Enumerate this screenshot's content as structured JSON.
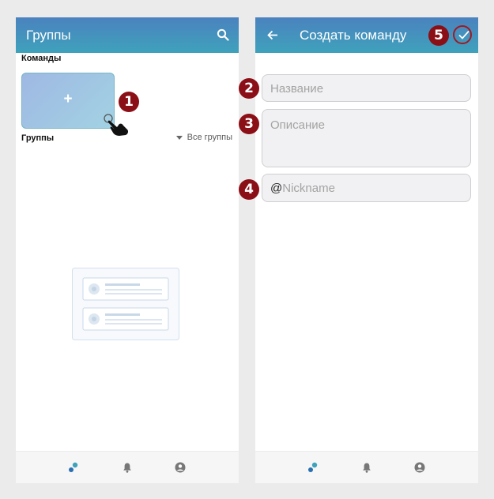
{
  "left_screen": {
    "appbar": {
      "title": "Группы",
      "search_icon": "search-icon"
    },
    "teams_label": "Команды",
    "add_team_card": {
      "plus": "+"
    },
    "groups_label": "Группы",
    "all_groups": "Все группы",
    "bottom_nav": {
      "icons": [
        "groups-icon",
        "bell-icon",
        "profile-icon"
      ],
      "active_color": "#3fa2bb"
    }
  },
  "right_screen": {
    "appbar": {
      "title": "Создать команду",
      "back_icon": "arrow-left-icon",
      "confirm_icon": "check-icon"
    },
    "fields": {
      "name_placeholder": "Название",
      "description_placeholder": "Описание",
      "nickname_prefix": "@",
      "nickname_placeholder": "Nickname"
    },
    "bottom_nav": {
      "icons": [
        "groups-icon",
        "bell-icon",
        "profile-icon"
      ],
      "active_color": "#3fa2bb"
    }
  },
  "annotations": [
    "1",
    "2",
    "3",
    "4",
    "5"
  ],
  "colors": {
    "appbar_start": "#4a82bf",
    "appbar_end": "#3fa2bb",
    "badge": "#8b0f16"
  }
}
